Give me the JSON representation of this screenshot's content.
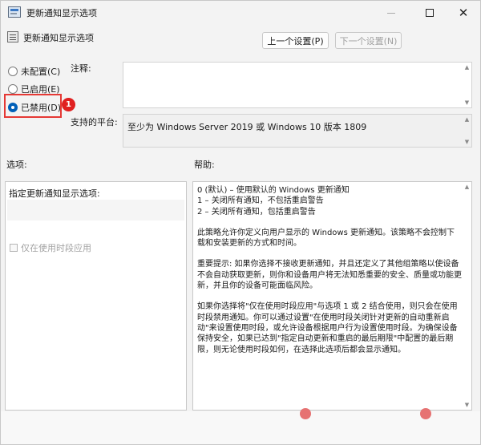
{
  "window": {
    "title": "更新通知显示选项",
    "policy_name": "更新通知显示选项"
  },
  "nav": {
    "prev_label": "上一个设置(P)",
    "next_label": "下一个设置(N)"
  },
  "state": {
    "options": [
      {
        "label": "未配置(C)",
        "checked": false
      },
      {
        "label": "已启用(E)",
        "checked": false
      },
      {
        "label": "已禁用(D)",
        "checked": true
      }
    ],
    "badge": "1"
  },
  "labels": {
    "comment": "注释:",
    "platform": "支持的平台:",
    "options": "选项:",
    "help": "帮助:"
  },
  "platform_value": "至少为 Windows Server 2019 或 Windows 10 版本 1809",
  "options_panel": {
    "field_label": "指定更新通知显示选项:",
    "checkbox_label": "仅在使用时段应用"
  },
  "help": {
    "lines": [
      "0 (默认) – 使用默认的 Windows 更新通知",
      "1 – 关闭所有通知，不包括重启警告",
      "2 – 关闭所有通知，包括重启警告"
    ],
    "para1": "此策略允许你定义向用户显示的 Windows 更新通知。该策略不会控制下载和安装更新的方式和时间。",
    "para2": "重要提示: 如果你选择不接收更新通知，并且还定义了其他组策略以使设备不会自动获取更新，则你和设备用户将无法知悉重要的安全、质量或功能更新，并且你的设备可能面临风险。",
    "para3": "如果你选择将\"仅在使用时段应用\"与选项 1 或 2 结合使用，则只会在使用时段禁用通知。你可以通过设置\"在使用时段关闭针对更新的自动重新启动\"来设置使用时段，或允许设备根据用户行为设置使用时段。为确保设备保持安全，如果已达到\"指定自动更新和重启的最后期限\"中配置的最后期限，则无论使用时段如何，在选择此选项后都会显示通知。"
  }
}
